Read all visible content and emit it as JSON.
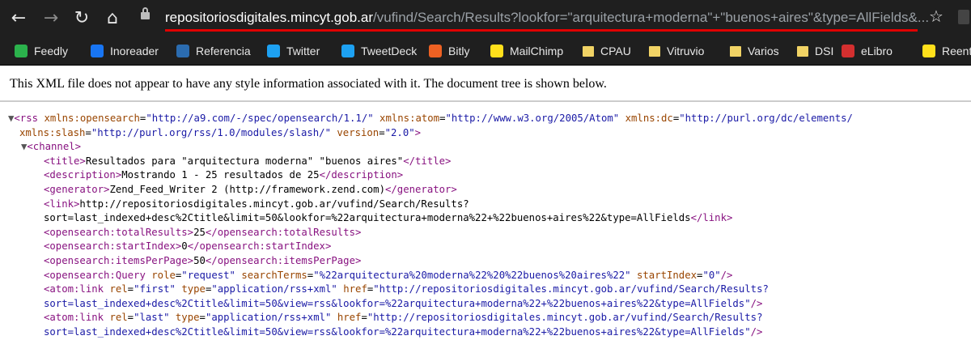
{
  "browser": {
    "url_host": "repositoriosdigitales.mincyt.gob.ar",
    "url_rest": "/vufind/Search/Results?lookfor=\"arquitectura+moderna\"+\"buenos+aires\"&type=AllFields&...",
    "bookmarks": [
      {
        "label": "Feedly",
        "icon": "feedly-icon",
        "color": "#2bb24c"
      },
      {
        "label": "Inoreader",
        "icon": "inoreader-icon",
        "color": "#1875f3"
      },
      {
        "label": "Referencia",
        "icon": "referencia-icon",
        "color": "#2b6cb0"
      },
      {
        "label": "Twitter",
        "icon": "twitter-icon",
        "color": "#1da1f2"
      },
      {
        "label": "TweetDeck",
        "icon": "tweetdeck-icon",
        "color": "#1da1f2"
      },
      {
        "label": "Bitly",
        "icon": "bitly-icon",
        "color": "#ee6123"
      },
      {
        "label": "MailChimp",
        "icon": "mailchimp-icon",
        "color": "#ffe01b"
      },
      {
        "label": "CPAU",
        "icon": "folder-icon",
        "color": "#f1d365"
      },
      {
        "label": "Vitruvio",
        "icon": "folder-icon",
        "color": "#f1d365"
      },
      {
        "label": "Varios",
        "icon": "folder-icon",
        "color": "#f1d365"
      },
      {
        "label": "DSI",
        "icon": "folder-icon",
        "color": "#f1d365"
      },
      {
        "label": "eLibro",
        "icon": "elibro-icon",
        "color": "#d32f2f"
      },
      {
        "label": "Reent",
        "icon": "reent-icon",
        "color": "#ffe01b"
      }
    ]
  },
  "page": {
    "notice": "This XML file does not appear to have any style information associated with it. The document tree is shown below."
  },
  "xml": {
    "rss_open": "<rss",
    "rss_attr1_name": "xmlns:opensearch",
    "rss_attr1_val": "\"http://a9.com/-/spec/opensearch/1.1/\"",
    "rss_attr2_name": "xmlns:atom",
    "rss_attr2_val": "\"http://www.w3.org/2005/Atom\"",
    "rss_attr3_name": "xmlns:dc",
    "rss_attr3_val": "\"http://purl.org/dc/elements/",
    "rss_attr4_name": "xmlns:slash",
    "rss_attr4_val": "\"http://purl.org/rss/1.0/modules/slash/\"",
    "rss_attr5_name": "version",
    "rss_attr5_val": "\"2.0\"",
    "channel_open": "<channel>",
    "title_open": "<title>",
    "title_text": "Resultados para \"arquitectura moderna\" \"buenos aires\"",
    "title_close": "</title>",
    "desc_open": "<description>",
    "desc_text": "Mostrando 1 - 25 resultados de 25",
    "desc_close": "</description>",
    "gen_open": "<generator>",
    "gen_text": "Zend_Feed_Writer 2 (http://framework.zend.com)",
    "gen_close": "</generator>",
    "link_open": "<link>",
    "link_text1": "http://repositoriosdigitales.mincyt.gob.ar/vufind/Search/Results?",
    "link_text2": "sort=last_indexed+desc%2Ctitle&limit=50&lookfor=%22arquitectura+moderna%22+%22buenos+aires%22&type=AllFields",
    "link_close": "</link>",
    "total_open": "<opensearch:totalResults>",
    "total_text": "25",
    "total_close": "</opensearch:totalResults>",
    "start_open": "<opensearch:startIndex>",
    "start_text": "0",
    "start_close": "</opensearch:startIndex>",
    "ipp_open": "<opensearch:itemsPerPage>",
    "ipp_text": "50",
    "ipp_close": "</opensearch:itemsPerPage>",
    "query_open": "<opensearch:Query",
    "query_a1": "role",
    "query_v1": "\"request\"",
    "query_a2": "searchTerms",
    "query_v2": "\"%22arquitectura%20moderna%22%20%22buenos%20aires%22\"",
    "query_a3": "startIndex",
    "query_v3": "\"0\"",
    "query_close": "/>",
    "al1_open": "<atom:link",
    "al1_a1": "rel",
    "al1_v1": "\"first\"",
    "al1_a2": "type",
    "al1_v2": "\"application/rss+xml\"",
    "al1_a3": "href",
    "al1_v3a": "\"http://repositoriosdigitales.mincyt.gob.ar/vufind/Search/Results?",
    "al1_v3b": "sort=last_indexed+desc%2Ctitle&limit=50&view=rss&lookfor=%22arquitectura+moderna%22+%22buenos+aires%22&type=AllFields\"",
    "al1_close": "/>",
    "al2_open": "<atom:link",
    "al2_a1": "rel",
    "al2_v1": "\"last\"",
    "al2_a2": "type",
    "al2_v2": "\"application/rss+xml\"",
    "al2_a3": "href",
    "al2_v3a": "\"http://repositoriosdigitales.mincyt.gob.ar/vufind/Search/Results?",
    "al2_v3b": "sort=last_indexed+desc%2Ctitle&limit=50&view=rss&lookfor=%22arquitectura+moderna%22+%22buenos+aires%22&type=AllFields\"",
    "al2_close": "/>"
  }
}
